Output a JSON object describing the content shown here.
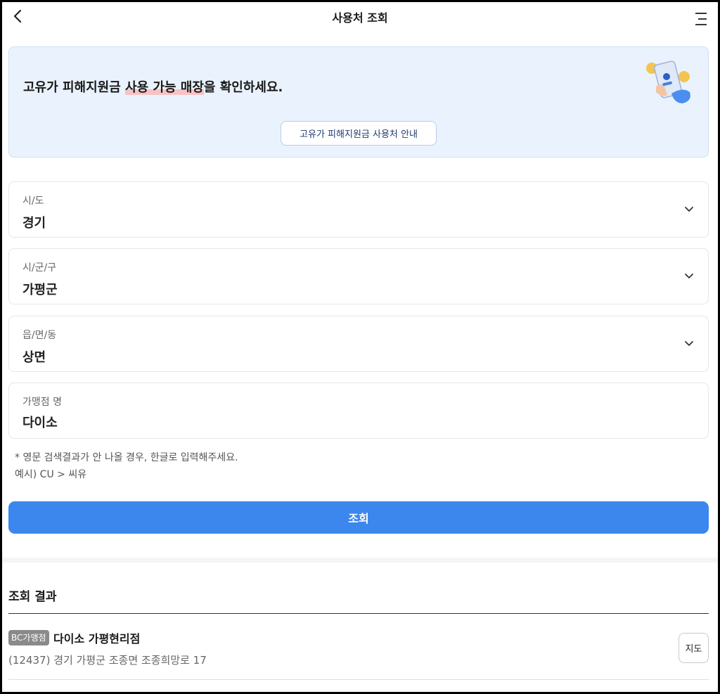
{
  "header": {
    "title": "사용처 조회",
    "back_icon": "chevron-left-icon",
    "menu_icon": "hamburger-menu-icon"
  },
  "banner": {
    "text_prefix": "고유가 피해지원금 ",
    "text_highlight": "사용 가능 매장",
    "text_suffix": "을 확인하세요.",
    "guide_button": "고유가 피해지원금 사용처 안내",
    "illustration_icon": "phone-coin-illustration-icon",
    "bg_color": "#eaf3fd"
  },
  "fields": {
    "sido": {
      "label": "시/도",
      "value": "경기"
    },
    "sigungu": {
      "label": "시/군/구",
      "value": "가평군"
    },
    "eupmyeondong": {
      "label": "읍/면/동",
      "value": "상면"
    },
    "store_name": {
      "label": "가맹점 명",
      "value": "다이소"
    }
  },
  "notes": {
    "line1": "* 영문 검색결과가 안 나올 경우, 한글로 입력해주세요.",
    "line2": "예시) CU > 씨유"
  },
  "search_button": {
    "label": "조회",
    "color": "#3b87ee"
  },
  "results": {
    "title": "조회 결과",
    "items": [
      {
        "badge": "BC가맹점",
        "name": "다이소 가평현리점",
        "address": "(12437) 경기 가평군 조종면 조종희망로 17",
        "map_button": "지도"
      }
    ]
  }
}
